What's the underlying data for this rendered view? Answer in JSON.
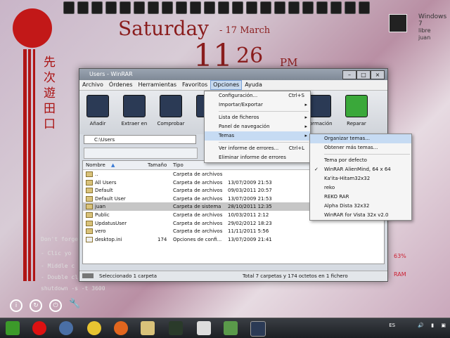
{
  "desktop": {
    "kanji": [
      "先",
      "次",
      "遊",
      "田",
      "口"
    ],
    "clock": {
      "day": "Saturday",
      "date": "- 17 March",
      "hour": "11",
      "minute": "26",
      "ampm": "PM"
    },
    "user": {
      "os": "Windows 7",
      "status": "libre",
      "name": "juan"
    },
    "note_lines": [
      "Don't forge",
      "- Clic yo",
      "- Middle c",
      "- Double cl",
      "shutdown -s -t 3600"
    ],
    "side_stats": [
      "63%",
      "RAM"
    ]
  },
  "window": {
    "title": "Users - WinRAR",
    "menu": [
      "Archivo",
      "Órdenes",
      "Herramientas",
      "Favoritos",
      "Opciones",
      "Ayuda"
    ],
    "toolbar": [
      "Añadir",
      "Extraer en",
      "Comprobar",
      "V",
      "formación",
      "Reparar"
    ],
    "address": "C:\\Users",
    "columns": [
      "Nombre",
      "Tamaño",
      "Tipo"
    ],
    "rows": [
      {
        "name": "..",
        "size": "",
        "type": "Carpeta de archivos",
        "date": ""
      },
      {
        "name": "All Users",
        "size": "",
        "type": "Carpeta de archivos",
        "date": "13/07/2009 21:53"
      },
      {
        "name": "Default",
        "size": "",
        "type": "Carpeta de archivos",
        "date": "09/03/2011 20:57"
      },
      {
        "name": "Default User",
        "size": "",
        "type": "Carpeta de archivos",
        "date": "13/07/2009 21:53"
      },
      {
        "name": "juan",
        "size": "",
        "type": "Carpeta de sistema",
        "date": "28/10/2011 12:35"
      },
      {
        "name": "Public",
        "size": "",
        "type": "Carpeta de archivos",
        "date": "10/03/2011 2:12"
      },
      {
        "name": "UpdatusUser",
        "size": "",
        "type": "Carpeta de archivos",
        "date": "29/02/2012 18:23"
      },
      {
        "name": "vero",
        "size": "",
        "type": "Carpeta de archivos",
        "date": "11/11/2011 5:56"
      },
      {
        "name": "desktop.ini",
        "size": "174",
        "type": "Opciones de confi...",
        "date": "13/07/2009 21:41"
      }
    ],
    "status_left": "Seleccionado 1 carpeta",
    "status_right": "Total 7 carpetas y 174 octetos en 1 fichero"
  },
  "opciones_menu": [
    {
      "label": "Configuración...",
      "shortcut": "Ctrl+S"
    },
    {
      "label": "Importar/Exportar",
      "arrow": true
    },
    {
      "sep": true
    },
    {
      "label": "Lista de ficheros",
      "arrow": true
    },
    {
      "label": "Panel de navegación",
      "arrow": true
    },
    {
      "label": "Temas",
      "arrow": true,
      "highlight": true
    },
    {
      "sep": true
    },
    {
      "label": "Ver informe de errores...",
      "shortcut": "Ctrl+L"
    },
    {
      "label": "Eliminar informe de errores"
    }
  ],
  "temas_menu": [
    {
      "label": "Organizar temas...",
      "highlight": true
    },
    {
      "label": "Obtener más temas..."
    },
    {
      "sep": true
    },
    {
      "label": "Tema por defecto"
    },
    {
      "label": "WinRAR AlienMind, 64 x 64",
      "checked": true
    },
    {
      "label": "Ka'ita-Hitam32x32"
    },
    {
      "label": "reko"
    },
    {
      "label": "REKO RAR"
    },
    {
      "label": "Alpha Dista 32x32"
    },
    {
      "label": "WinRAR for Vista 32x v2.0"
    }
  ],
  "taskbar": {
    "lang": "ES"
  }
}
